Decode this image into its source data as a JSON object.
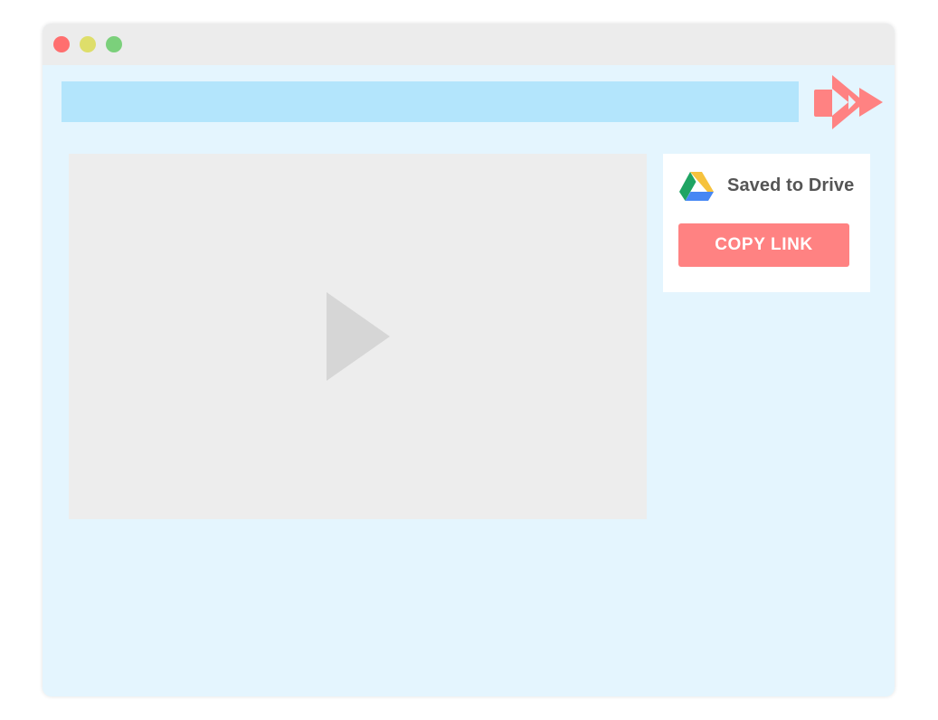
{
  "window": {
    "controls": [
      "close",
      "minimize",
      "maximize"
    ]
  },
  "address_bar": {
    "value": ""
  },
  "logo": {
    "icon": "video-camera-arrow-logo-icon",
    "color": "#ff8282"
  },
  "video": {
    "icon": "play-icon",
    "background": "#ededed"
  },
  "drive_panel": {
    "icon": "google-drive-icon",
    "status": "Saved to Drive",
    "button_label": "COPY LINK",
    "button_color": "#ff8282"
  },
  "colors": {
    "window_background": "#e4f5fe",
    "titlebar": "#ececec",
    "address_bar": "#b3e5fc",
    "close_dot": "#ff6f6f",
    "minimize_dot": "#dede6a",
    "maximize_dot": "#7bd07b"
  }
}
